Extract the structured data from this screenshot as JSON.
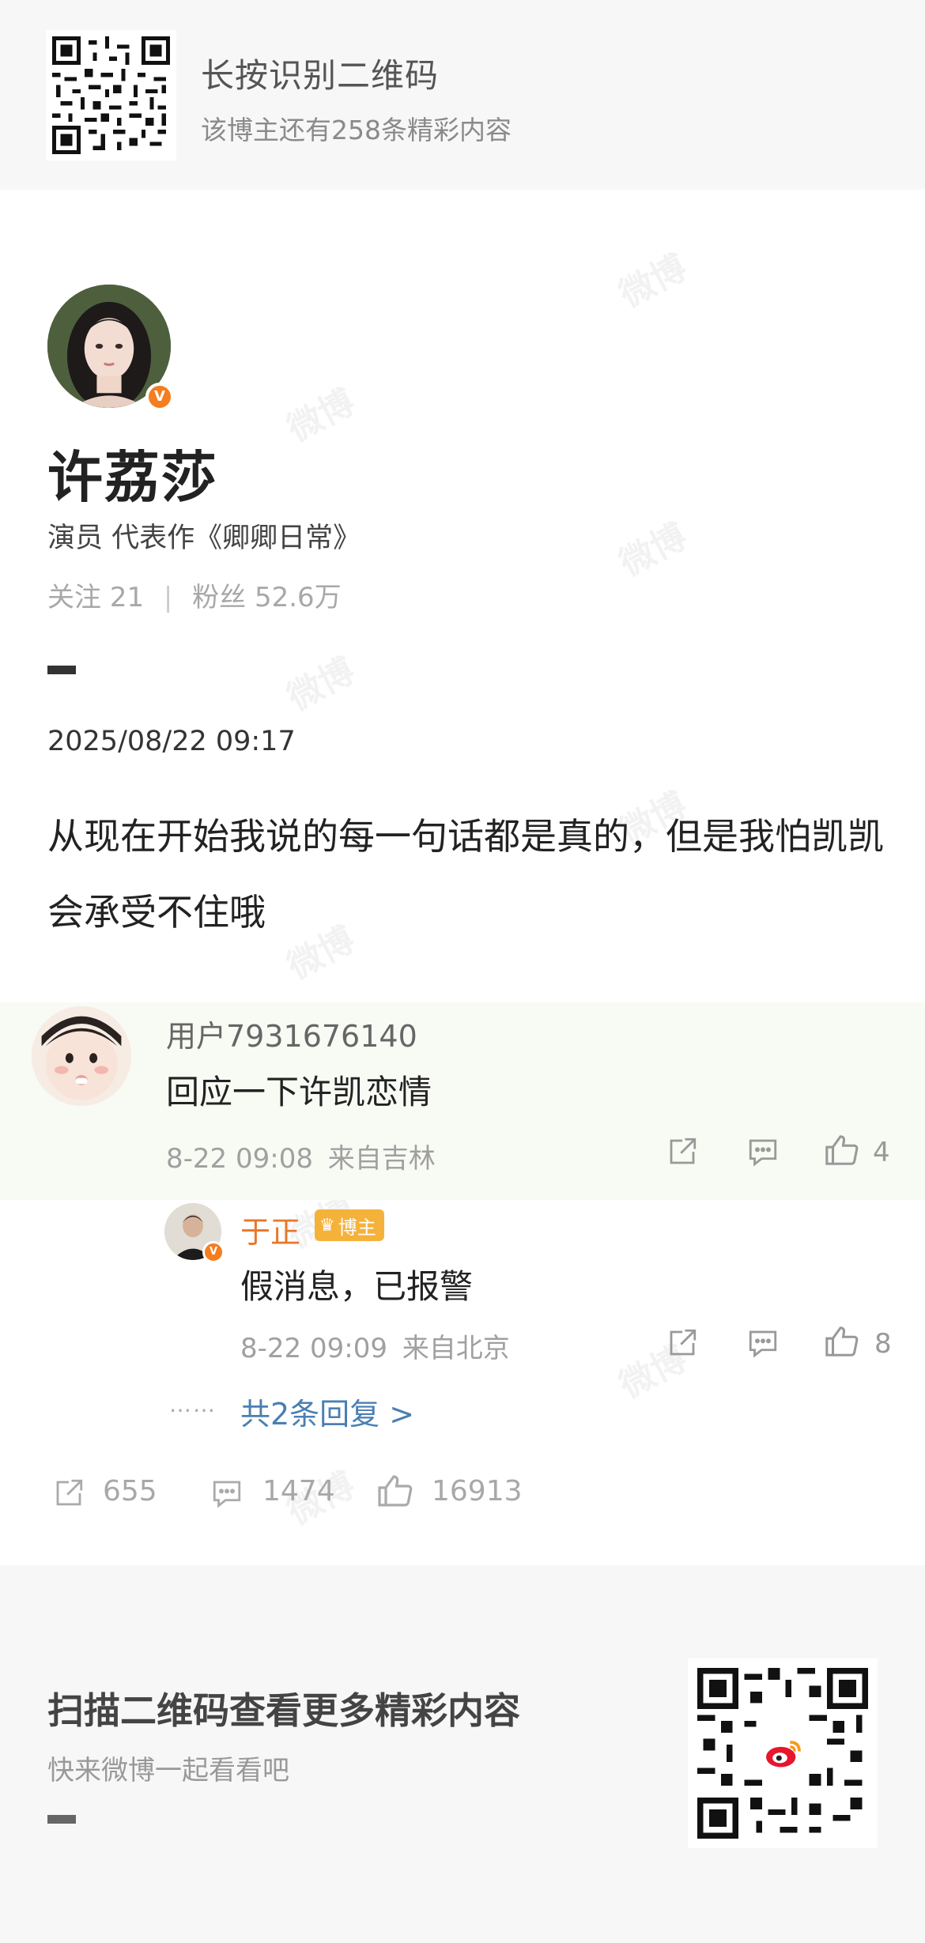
{
  "top_banner": {
    "title": "长按识别二维码",
    "subtitle": "该博主还有258条精彩内容"
  },
  "profile": {
    "name": "许荔莎",
    "bio": "演员 代表作《卿卿日常》",
    "following_label": "关注",
    "following_count": "21",
    "fans_label": "粉丝",
    "fans_count": "52.6万",
    "verified_badge": "V"
  },
  "post": {
    "date": "2025/08/22 09:17",
    "text": "从现在开始我说的每一句话都是真的，但是我怕凯凯会承受不住哦",
    "reposts": "655",
    "comments": "1474",
    "likes": "16913"
  },
  "comment": {
    "user": "用户7931676140",
    "text": "回应一下许凯恋情",
    "time": "8-22 09:08",
    "location": "来自吉林",
    "likes": "4"
  },
  "reply": {
    "user": "于正",
    "badge": "博主",
    "text": "假消息，已报警",
    "time": "8-22 09:09",
    "location": "来自北京",
    "likes": "8",
    "more_dots": "……",
    "more_link": "共2条回复 >"
  },
  "bottom_banner": {
    "title": "扫描二维码查看更多精彩内容",
    "subtitle": "快来微博一起看看吧"
  },
  "watermark": "微博",
  "colors": {
    "banner_bg": "#f7f7f7",
    "comment_bg": "#f8faf4",
    "verified_orange": "#f47d20",
    "link_blue": "#4a7fb3",
    "reply_name_orange": "#e8772a"
  },
  "icons": [
    "share-icon",
    "comment-icon",
    "like-icon",
    "verified-icon",
    "crown-icon",
    "weibo-logo-icon"
  ]
}
